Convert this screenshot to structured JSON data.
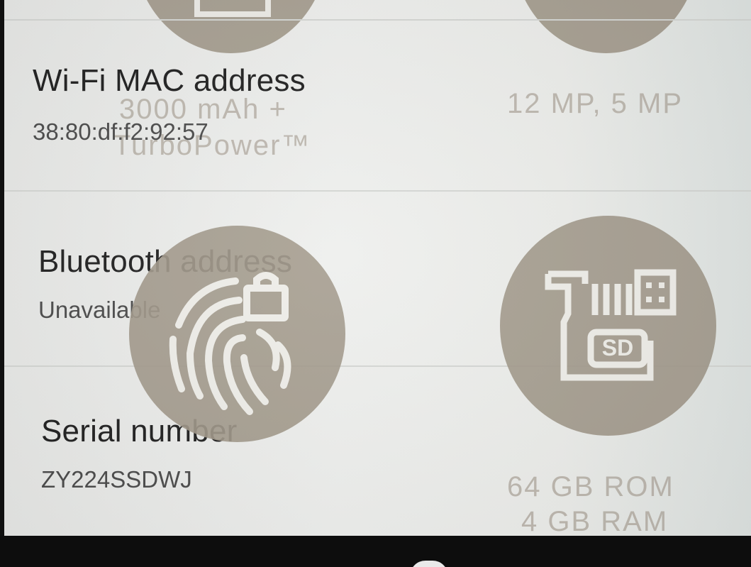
{
  "settings_list": {
    "rows": [
      {
        "title": "Wi-Fi MAC address",
        "value": "38:80:df:f2:92:57"
      },
      {
        "title": "Bluetooth address",
        "value": "Unavailable"
      },
      {
        "title": "Serial number",
        "value": "ZY224SSDWJ"
      }
    ]
  },
  "overlay_specs": {
    "battery": {
      "line1": "3000 mAh +",
      "line2": "TurboPower™",
      "icon": "battery-icon"
    },
    "camera": {
      "text": "12 MP, 5 MP",
      "icon": "camera-icon"
    },
    "fingerprint": {
      "icon": "fingerprint-lock-icon"
    },
    "storage": {
      "line1": "64 GB ROM",
      "line2": "4 GB RAM",
      "icon": "sd-card-icon",
      "badge": "SD"
    }
  },
  "colors": {
    "background": "#ecedea",
    "primary_text": "#1f1f1f",
    "secondary_text": "#4a4a4a",
    "overlay_circle": "#a09788",
    "overlay_text": "#b3aca2",
    "nav_bar": "#0d0d0d"
  }
}
